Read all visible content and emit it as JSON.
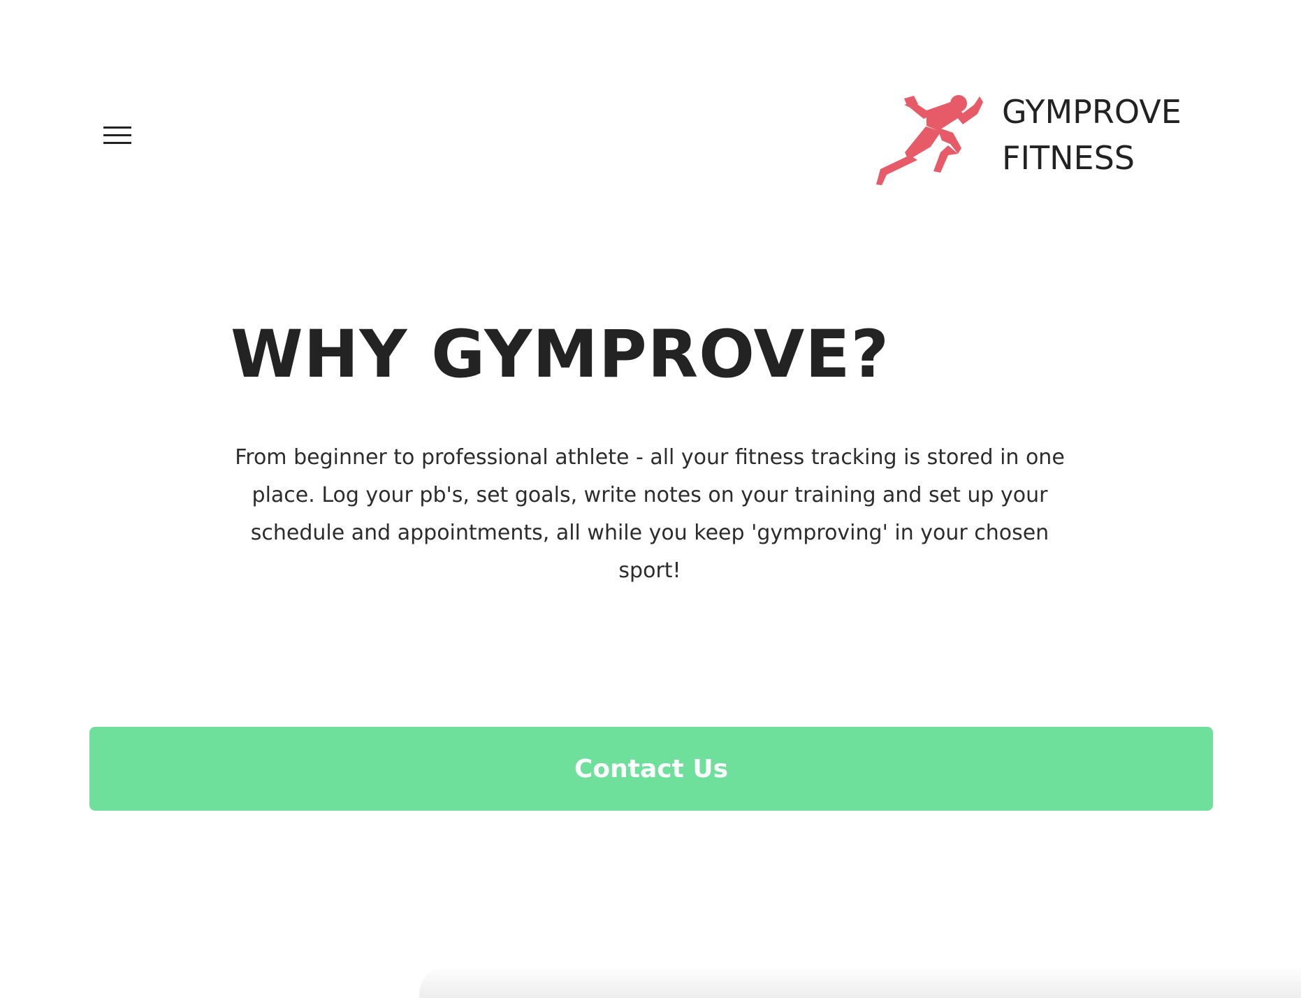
{
  "header": {
    "menu_icon": "hamburger-menu-icon",
    "logo_icon": "running-athlete-icon",
    "brand_line1": "GYMPROVE",
    "brand_line2": "FITNESS"
  },
  "hero": {
    "title": "WHY GYMPROVE?",
    "description": "From beginner to professional athlete - all your fitness tracking is stored in one place. Log your pb's, set goals, write notes on your training and set up your schedule and appointments, all while you keep 'gymproving' in your chosen sport!"
  },
  "cta": {
    "label": "Contact Us"
  },
  "colors": {
    "accent_red": "#e65b67",
    "cta_green": "#6ee09b",
    "text_dark": "#222222",
    "background": "#ffffff"
  }
}
